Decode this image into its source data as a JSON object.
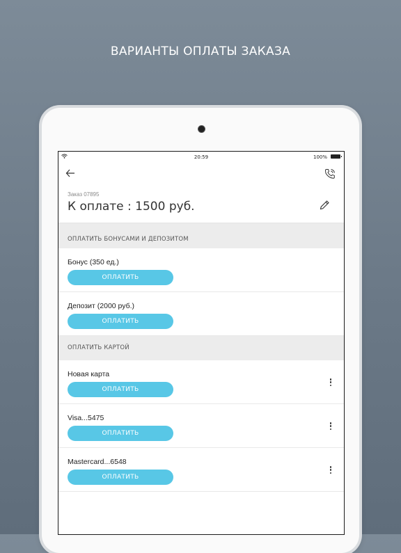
{
  "headline": "ВАРИАНТЫ ОПЛАТЫ ЗАКАЗА",
  "status_bar": {
    "time": "20:59",
    "battery": "100%"
  },
  "order": {
    "number": "Заказ 07895",
    "amount": "К оплате : 1500 руб."
  },
  "sections": {
    "bonus": {
      "title": "ОПЛАТИТЬ БОНУСАМИ И ДЕПОЗИТОМ",
      "items": [
        {
          "label": "Бонус (350 ед.)",
          "button": "ОПЛАТИТЬ"
        },
        {
          "label": "Депозит (2000 руб.)",
          "button": "ОПЛАТИТЬ"
        }
      ]
    },
    "card": {
      "title": "ОПЛАТИТЬ КАРТОЙ",
      "items": [
        {
          "label": "Новая карта",
          "button": "ОПЛАТИТЬ"
        },
        {
          "label": "Visa...5475",
          "button": "ОПЛАТИТЬ"
        },
        {
          "label": "Mastercard...6548",
          "button": "ОПЛАТИТЬ"
        }
      ]
    }
  },
  "icons": {
    "back": "back-arrow-icon",
    "phone": "phone-icon",
    "edit": "pencil-icon",
    "more": "more-vertical-icon",
    "wifi": "wifi-icon",
    "battery": "battery-icon"
  },
  "colors": {
    "accent": "#58c7e6",
    "background": "#6f7d8b",
    "section": "#ececec"
  }
}
